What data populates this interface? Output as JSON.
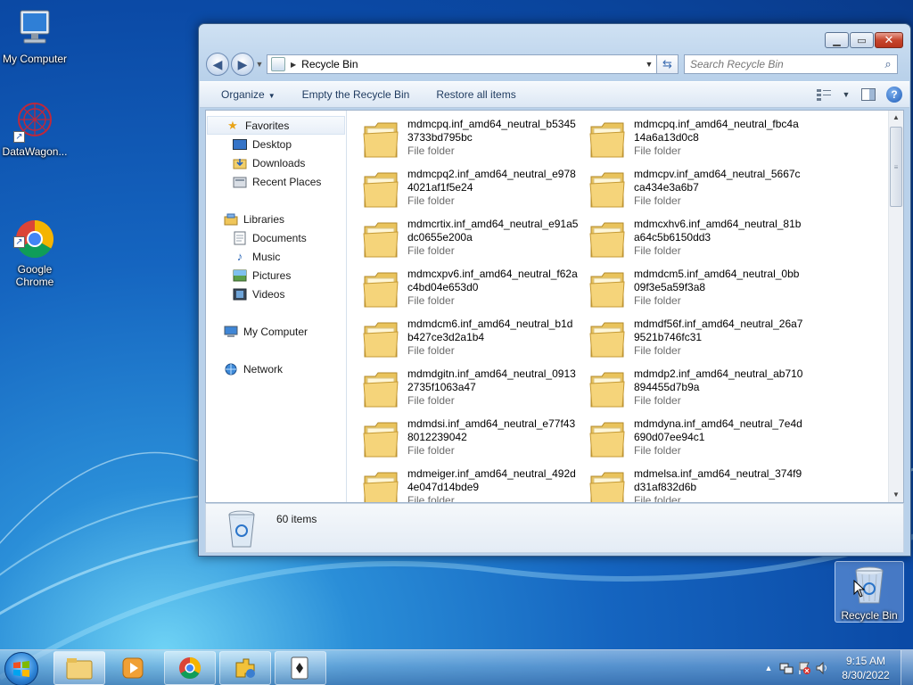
{
  "desktop": {
    "icons": [
      {
        "label": "My Computer"
      },
      {
        "label": "DataWagon..."
      },
      {
        "label": "Google\nChrome"
      },
      {
        "label": "Recycle Bin"
      }
    ]
  },
  "window": {
    "address": {
      "crumb": "Recycle Bin"
    },
    "search": {
      "placeholder": "Search Recycle Bin"
    },
    "toolbar": {
      "organize": "Organize",
      "empty": "Empty the Recycle Bin",
      "restore": "Restore all items"
    },
    "nav": {
      "favorites": "Favorites",
      "desktop": "Desktop",
      "downloads": "Downloads",
      "recent": "Recent Places",
      "libraries": "Libraries",
      "documents": "Documents",
      "music": "Music",
      "pictures": "Pictures",
      "videos": "Videos",
      "computer": "My Computer",
      "network": "Network"
    },
    "files": [
      {
        "name": "mdmcpq.inf_amd64_neutral_b5345\n3733bd795bc",
        "type": "File folder"
      },
      {
        "name": "mdmcpq.inf_amd64_neutral_fbc4a\n14a6a13d0c8",
        "type": "File folder"
      },
      {
        "name": "mdmcpq2.inf_amd64_neutral_e978\n4021af1f5e24",
        "type": "File folder"
      },
      {
        "name": "mdmcpv.inf_amd64_neutral_5667c\nca434e3a6b7",
        "type": "File folder"
      },
      {
        "name": "mdmcrtix.inf_amd64_neutral_e91a5\ndc0655e200a",
        "type": "File folder"
      },
      {
        "name": "mdmcxhv6.inf_amd64_neutral_81b\na64c5b6150dd3",
        "type": "File folder"
      },
      {
        "name": "mdmcxpv6.inf_amd64_neutral_f62a\nc4bd04e653d0",
        "type": "File folder"
      },
      {
        "name": "mdmdcm5.inf_amd64_neutral_0bb\n09f3e5a59f3a8",
        "type": "File folder"
      },
      {
        "name": "mdmdcm6.inf_amd64_neutral_b1d\nb427ce3d2a1b4",
        "type": "File folder"
      },
      {
        "name": "mdmdf56f.inf_amd64_neutral_26a7\n9521b746fc31",
        "type": "File folder"
      },
      {
        "name": "mdmdgitn.inf_amd64_neutral_0913\n2735f1063a47",
        "type": "File folder"
      },
      {
        "name": "mdmdp2.inf_amd64_neutral_ab710\n894455d7b9a",
        "type": "File folder"
      },
      {
        "name": "mdmdsi.inf_amd64_neutral_e77f43\n8012239042",
        "type": "File folder"
      },
      {
        "name": "mdmdyna.inf_amd64_neutral_7e4d\n690d07ee94c1",
        "type": "File folder"
      },
      {
        "name": "mdmeiger.inf_amd64_neutral_492d\n4e047d14bde9",
        "type": "File folder"
      },
      {
        "name": "mdmelsa.inf_amd64_neutral_374f9\nd31af832d6b",
        "type": "File folder"
      }
    ],
    "status": {
      "count": "60 items"
    }
  },
  "taskbar": {
    "clock": {
      "time": "9:15 AM",
      "date": "8/30/2022"
    }
  }
}
